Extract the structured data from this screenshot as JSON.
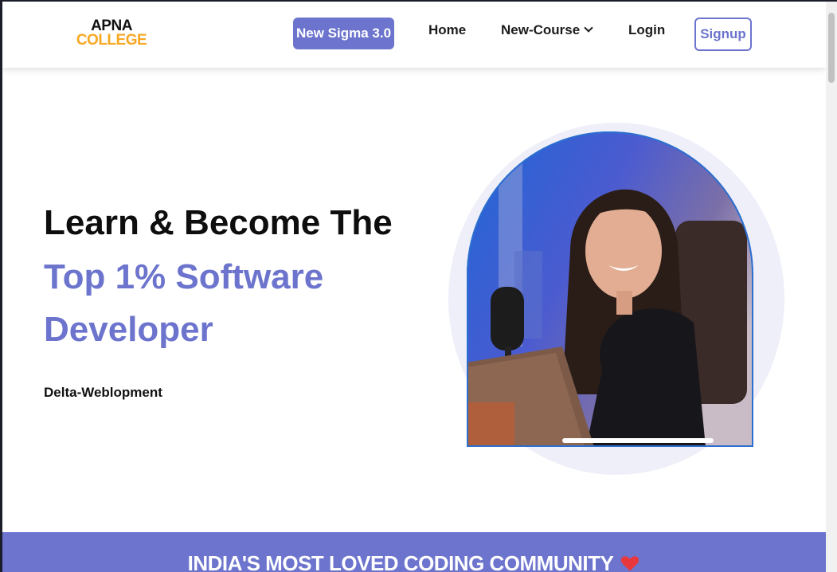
{
  "logo": {
    "line1": "APNA",
    "line2": "COLLEGE"
  },
  "nav": {
    "sigma_label": "New Sigma 3.0",
    "home_label": "Home",
    "course_label": "New-Course",
    "login_label": "Login",
    "signup_label": "Signup"
  },
  "hero": {
    "line1": "Learn & Become The",
    "line2": "Top 1% Software",
    "line3": "Developer",
    "subtitle": "Delta-Weblopment"
  },
  "banner": {
    "text": "INDIA'S MOST LOVED CODING COMMUNITY"
  },
  "colors": {
    "accent": "#6c74cd",
    "brand_orange": "#f7a823",
    "halo": "#eeeff8"
  },
  "icons": {
    "course_dropdown": "chevron-down-icon",
    "banner_icon": "heart-icon"
  }
}
